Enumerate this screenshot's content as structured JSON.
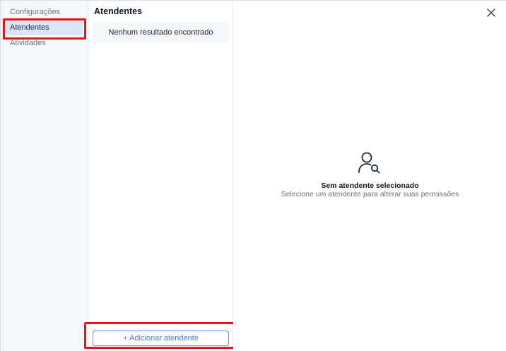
{
  "sidebar": {
    "items": [
      {
        "label": "Configurações",
        "active": false
      },
      {
        "label": "Atendentes",
        "active": true
      },
      {
        "label": "Atividades",
        "active": false
      }
    ]
  },
  "list": {
    "title": "Atendentes",
    "empty_message": "Nenhum resultado encontrado",
    "add_button_label": "+ Adicionar atendente"
  },
  "detail": {
    "empty_title": "Sem atendente selecionado",
    "empty_subtitle": "Selecione um atendente para alterar suas permissões",
    "icon": "user-search-icon",
    "close_icon": "close-icon"
  },
  "colors": {
    "highlight": "#e8141b",
    "active_nav_bg": "#dbe5f7",
    "accent": "#4a7fd4"
  }
}
